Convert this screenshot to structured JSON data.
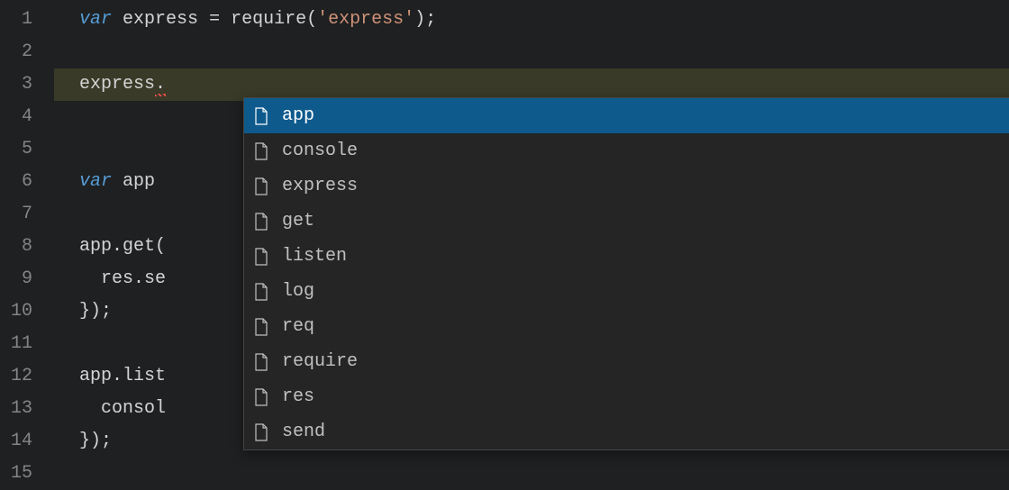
{
  "gutter": {
    "line_numbers": [
      "1",
      "2",
      "3",
      "4",
      "5",
      "6",
      "7",
      "8",
      "9",
      "10",
      "11",
      "12",
      "13",
      "14",
      "15"
    ]
  },
  "code": {
    "line1": {
      "kw_var": "var",
      "sp1": " ",
      "ident": "express",
      "sp2": " ",
      "eq": "=",
      "sp3": " ",
      "fn": "require",
      "paren_open": "(",
      "quote_open": "'",
      "str": "express",
      "quote_close": "'",
      "paren_close": ")",
      "semi": ";"
    },
    "line3": {
      "ident": "express",
      "dot": "."
    },
    "line6": {
      "kw_var": "var",
      "sp1": " ",
      "ident": "app",
      "sp2": " "
    },
    "line8": {
      "text": "app.get("
    },
    "line9": {
      "text": "  res.se"
    },
    "line10": {
      "text": "});"
    },
    "line12": {
      "text": "app.list"
    },
    "line13": {
      "text": "  consol"
    },
    "line14": {
      "text": "});"
    }
  },
  "autocomplete": {
    "selected_index": 0,
    "items": [
      {
        "label": "app",
        "icon": "file"
      },
      {
        "label": "console",
        "icon": "file"
      },
      {
        "label": "express",
        "icon": "file"
      },
      {
        "label": "get",
        "icon": "file"
      },
      {
        "label": "listen",
        "icon": "file"
      },
      {
        "label": "log",
        "icon": "file"
      },
      {
        "label": "req",
        "icon": "file"
      },
      {
        "label": "require",
        "icon": "file"
      },
      {
        "label": "res",
        "icon": "file"
      },
      {
        "label": "send",
        "icon": "file"
      }
    ]
  }
}
